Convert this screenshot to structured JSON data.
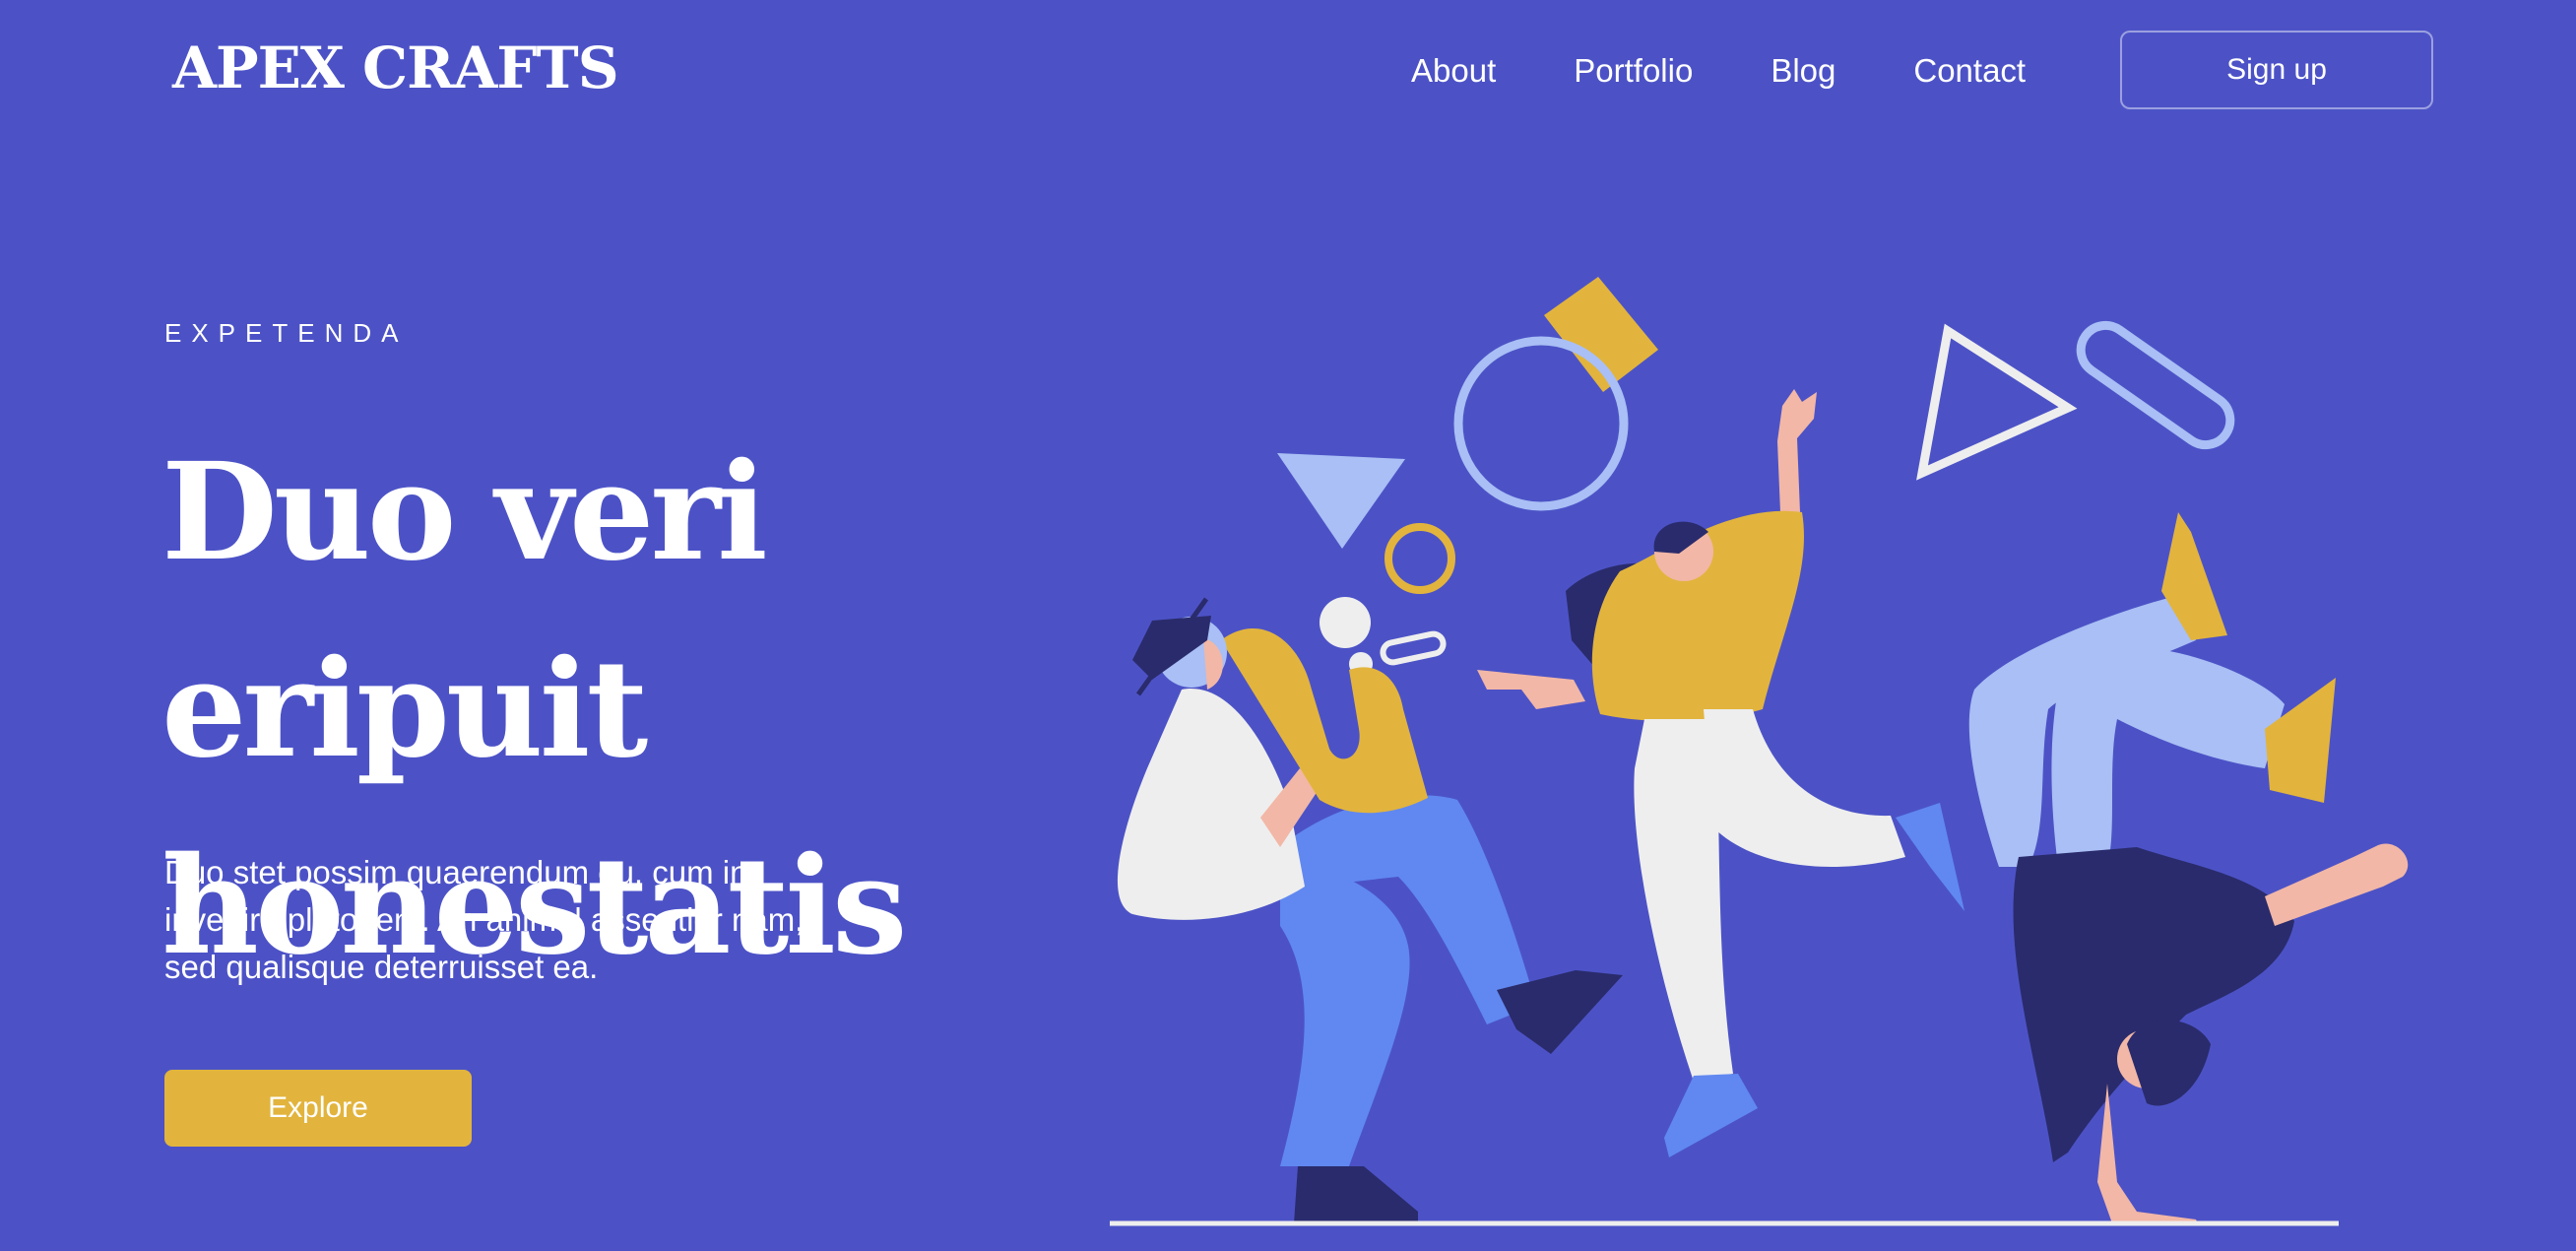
{
  "brand": {
    "name": "APEX CRAFTS"
  },
  "nav": {
    "items": [
      {
        "label": "About"
      },
      {
        "label": "Portfolio"
      },
      {
        "label": "Blog"
      },
      {
        "label": "Contact"
      }
    ],
    "signup_label": "Sign up"
  },
  "hero": {
    "eyebrow": "EXPETENDA",
    "headline_line1": "Duo veri eripuit",
    "headline_line2": "honestatis",
    "description": "Duo stet possim quaerendum eu, cum in invenire platonem. An animal assentior nam, sed qualisque deterruisset ea.",
    "cta_label": "Explore"
  },
  "colors": {
    "background": "#4c52c6",
    "accent_yellow": "#e2b43d",
    "light_blue": "#a9bff5",
    "mid_blue": "#6088f0",
    "navy": "#2a2b6c",
    "skin": "#f2b7a6",
    "white_cloth": "#eeeeee"
  },
  "illustration": {
    "subject": "three-people-dancing-illustration",
    "figures": [
      "saxophone-player",
      "dancer-with-raised-arm",
      "breakdancer-handstand"
    ]
  }
}
